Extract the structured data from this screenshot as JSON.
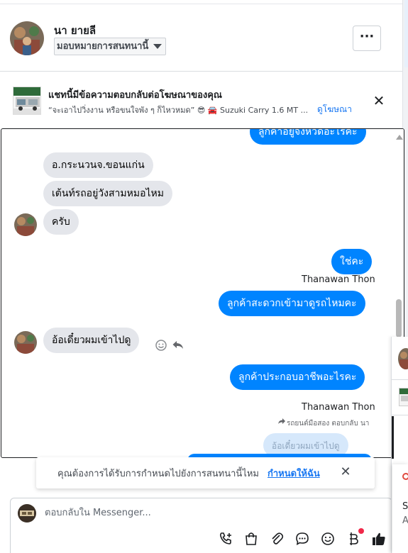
{
  "header": {
    "contact_name": "นา ยายลี",
    "assign_label": "มอบหมายการสนทนานี้",
    "more_label": "···"
  },
  "ad_notice": {
    "title": "แชทนี้มีข้อความตอบกลับต่อโฆษณาของคุณ",
    "subtitle": "“จะเอาไปวิ่งงาน หรือขนใจพัง ๆ ก็ไหวหมด” 😎 🚘 Suzuki Carry 1.6 MT ...",
    "link": "ดูโฆษณา",
    "close": "✕"
  },
  "messages": {
    "m0_partial": "ลูกค้าอยู่จังหวัดอะไรคะ",
    "m1": "อ.กระนวนจ.ขอนแก่น",
    "m2": "เต้นท์รถอยู่วังสามหมอไหม",
    "m3": "ครับ",
    "m4": "ใช่คะ",
    "sender1": "Thanawan Thon",
    "m5": "ลูกค้าสะดวกเข้ามาดูรถไหมคะ",
    "m6": "อ้อเดี๋ยวผมเข้าไปดู",
    "m7": "ลูกค้าประกอบอาชีพอะไรคะ",
    "sender2": "Thanawan Thon",
    "reply_context": "รถยนต์มือสอง ตอบกลับ นา",
    "m8_quoted": "อ้อเดี๋ยวผมเข้าไปดู"
  },
  "assign_banner": {
    "text": "คุณต้องการได้รับการกำหนดไปยังการสนทนานี้ไหม",
    "link": "กำหนดให้ฉัน",
    "close": "✕"
  },
  "composer": {
    "placeholder": "ตอบกลับใน Messenger...",
    "value": ""
  },
  "side_panel": {
    "letter1": "S",
    "letter2": "A"
  },
  "colors": {
    "outgoing_bubble": "#0084ff",
    "incoming_bubble": "#e4e6eb",
    "link": "#1877f2",
    "notify_dot": "#f02849"
  },
  "icons": [
    "more-icon",
    "close-icon",
    "smiley-icon",
    "reply-icon",
    "call-add-icon",
    "shopping-bag-icon",
    "paperclip-icon",
    "chat-bubble-icon",
    "emoji-icon",
    "baht-icon",
    "thumbs-up-icon",
    "forward-arrow-icon"
  ]
}
